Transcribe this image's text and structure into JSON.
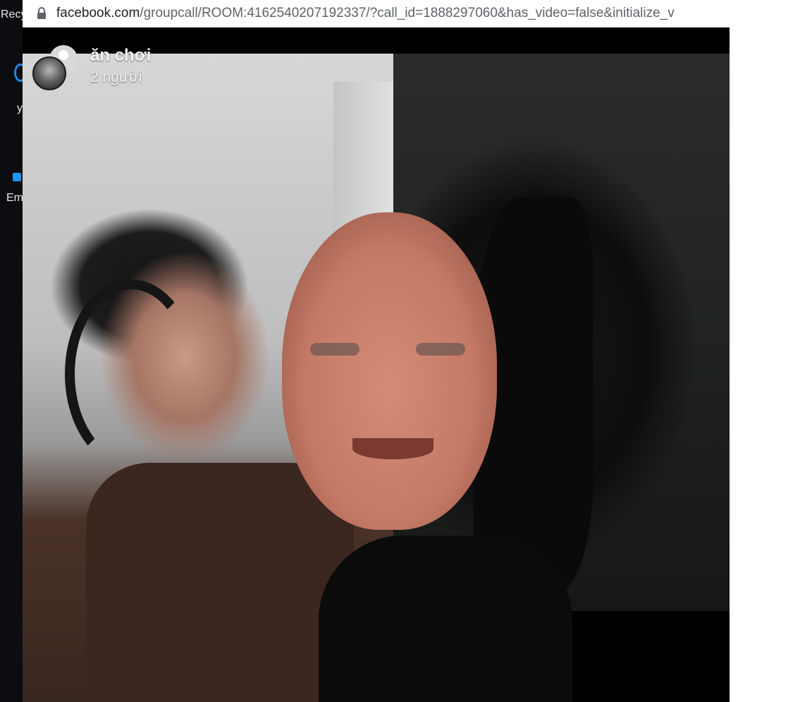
{
  "desktop": {
    "icons": [
      {
        "label": "Recy",
        "icon": "recycle-bin-icon",
        "color": "#1e88e5"
      },
      {
        "label": "y",
        "icon": "app-shortcut-icon",
        "color": "#2196f3"
      },
      {
        "label": "Em",
        "icon": "app-shortcut-icon",
        "color": "#2196f3"
      }
    ]
  },
  "browser": {
    "address_host": "facebook.com",
    "address_path": "/groupcall/ROOM:4162540207192337/?call_id=1888297060&has_video=false&initialize_v"
  },
  "call": {
    "group_name": "ăn chơi",
    "participant_count": "2 người"
  },
  "colors": {
    "background": "#000000",
    "header_text": "#f2f2f2",
    "address_bar": "#ffffff"
  }
}
